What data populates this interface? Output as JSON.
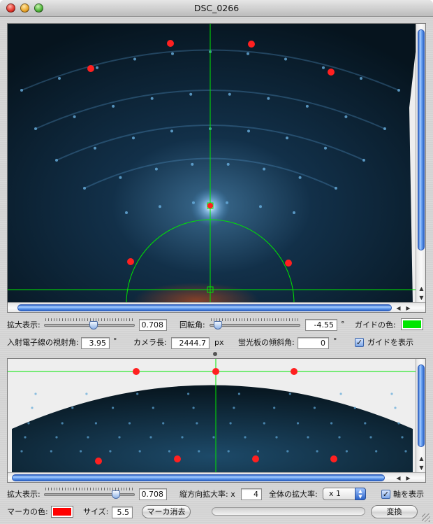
{
  "window": {
    "title": "DSC_0266"
  },
  "top_controls": {
    "zoom_label": "拡大表示:",
    "zoom_value": "0.708",
    "zoom_level": 0.55,
    "rotation_label": "回転角:",
    "rotation_value": "-4.55",
    "rotation_unit": "°",
    "rotation_level": 0.05,
    "guide_color_label": "ガイドの色:",
    "guide_color": "#00e600",
    "glancing_label": "入射電子線の視射角:",
    "glancing_value": "3.95",
    "glancing_unit": "°",
    "camera_label": "カメラ長:",
    "camera_value": "2444.7",
    "camera_unit": "px",
    "tilt_label": "蛍光板の傾斜角:",
    "tilt_value": "0",
    "tilt_unit": "°",
    "show_guide_label": "ガイドを表示",
    "show_guide_checked": "✓"
  },
  "bottom_controls": {
    "zoom_label": "拡大表示:",
    "zoom_value": "0.708",
    "zoom_level": 0.82,
    "vertical_scale_label": "縦方向拡大率: x",
    "vertical_scale_value": "4",
    "overall_scale_label": "全体の拡大率:",
    "overall_scale_value": "x 1",
    "show_axes_label": "軸を表示",
    "show_axes_checked": "✓",
    "marker_color_label": "マーカの色:",
    "marker_color": "#ff0000",
    "size_label": "サイズ:",
    "size_value": "5.5",
    "clear_markers_label": "マーカ消去",
    "convert_label": "変換"
  },
  "colors": {
    "marker": "#ff2020",
    "guide": "#00e600",
    "pattern_bg": "#0a2030",
    "scroll_thumb": "#5b96ea"
  }
}
